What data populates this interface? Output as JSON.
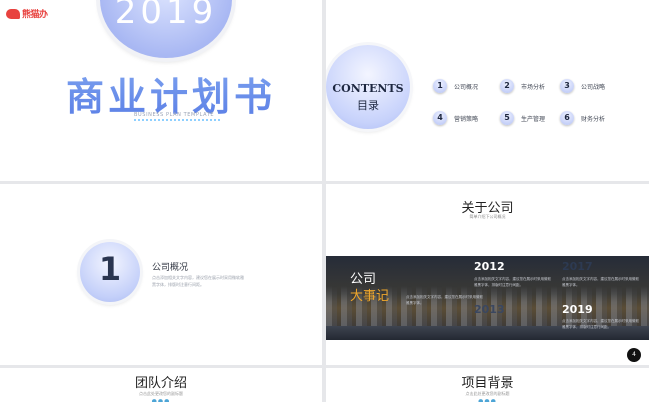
{
  "slide1": {
    "logo_text": "熊猫办",
    "year": "2019",
    "title": "商业计划书",
    "subtitle": "BUSINESS PLAN TEMPLATE"
  },
  "slide2": {
    "heading_en": "CONTENTS",
    "heading_cn": "目录",
    "items": [
      {
        "num": "1",
        "label": "公司概况"
      },
      {
        "num": "2",
        "label": "市场分析"
      },
      {
        "num": "3",
        "label": "公司战略"
      },
      {
        "num": "4",
        "label": "营销策略"
      },
      {
        "num": "5",
        "label": "生产管理"
      },
      {
        "num": "6",
        "label": "财务分析"
      }
    ]
  },
  "slide3": {
    "number": "1",
    "title": "公司概况",
    "text": "点击添加相关文字内容，建议您在展示时采用微软雅黑字体，排版时注意行间距。"
  },
  "slide4": {
    "title": "关于公司",
    "subtitle": "简单介绍下公司概况",
    "banner_line1": "公司",
    "banner_line2": "大事记",
    "events": [
      {
        "year": "2012",
        "text": "点击添加相关文字内容，建议您在展示时采用微软雅黑字体，排版时注意行间距。"
      },
      {
        "year": "2017",
        "text": "点击添加相关文字内容，建议您在展示时采用微软雅黑字体。"
      },
      {
        "year": "2013",
        "text": "点击添加相关文字内容，建议您在展示时采用微软雅黑字体。"
      },
      {
        "year": "2019",
        "text": "点击添加相关文字内容，建议您在展示时采用微软雅黑字体，排版时注意行间距。"
      }
    ],
    "page_number": "4"
  },
  "slide5": {
    "title": "团队介绍",
    "subtitle": "点击此处更改您的副标题"
  },
  "slide6": {
    "title": "项目背景",
    "subtitle": "点击此处更改您的副标题"
  }
}
